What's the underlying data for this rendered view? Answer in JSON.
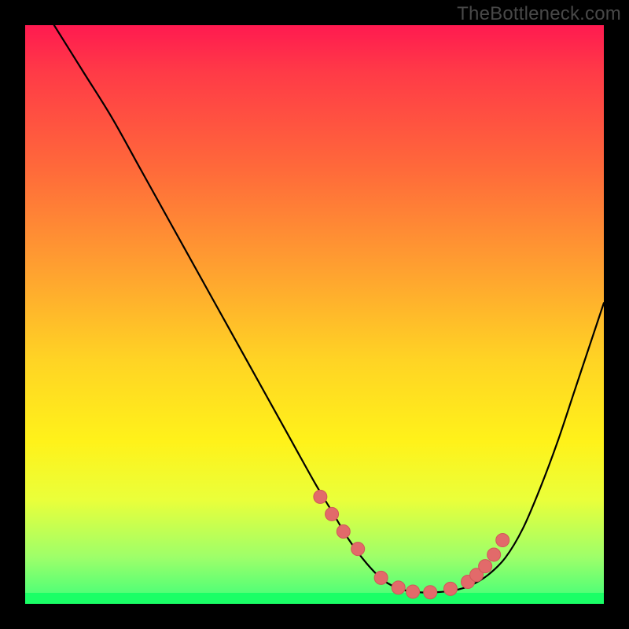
{
  "watermark": "TheBottleneck.com",
  "colors": {
    "curve_stroke": "#000000",
    "point_fill": "#e26a6a",
    "point_stroke": "#d05858"
  },
  "chart_data": {
    "type": "line",
    "title": "",
    "xlabel": "",
    "ylabel": "",
    "xlim": [
      0,
      100
    ],
    "ylim": [
      0,
      100
    ],
    "series": [
      {
        "name": "bottleneck-curve",
        "x": [
          5,
          10,
          15,
          20,
          25,
          30,
          35,
          40,
          45,
          50,
          53,
          56,
          59,
          62,
          65,
          68,
          71,
          74,
          77,
          80,
          83,
          86,
          89,
          92,
          95,
          98,
          100
        ],
        "y": [
          100,
          92,
          84,
          75,
          66,
          57,
          48,
          39,
          30,
          21,
          16,
          11,
          7,
          4,
          2.5,
          2,
          2,
          2.3,
          3.2,
          5,
          8,
          13,
          20,
          28,
          37,
          46,
          52
        ]
      }
    ],
    "points": {
      "name": "highlighted-points",
      "x": [
        51,
        53,
        55,
        57.5,
        61.5,
        64.5,
        67,
        70,
        73.5,
        76.5,
        78,
        79.5,
        81,
        82.5
      ],
      "y": [
        18.5,
        15.5,
        12.5,
        9.5,
        4.5,
        2.8,
        2.1,
        2.0,
        2.6,
        3.8,
        5.0,
        6.5,
        8.5,
        11.0
      ]
    }
  }
}
